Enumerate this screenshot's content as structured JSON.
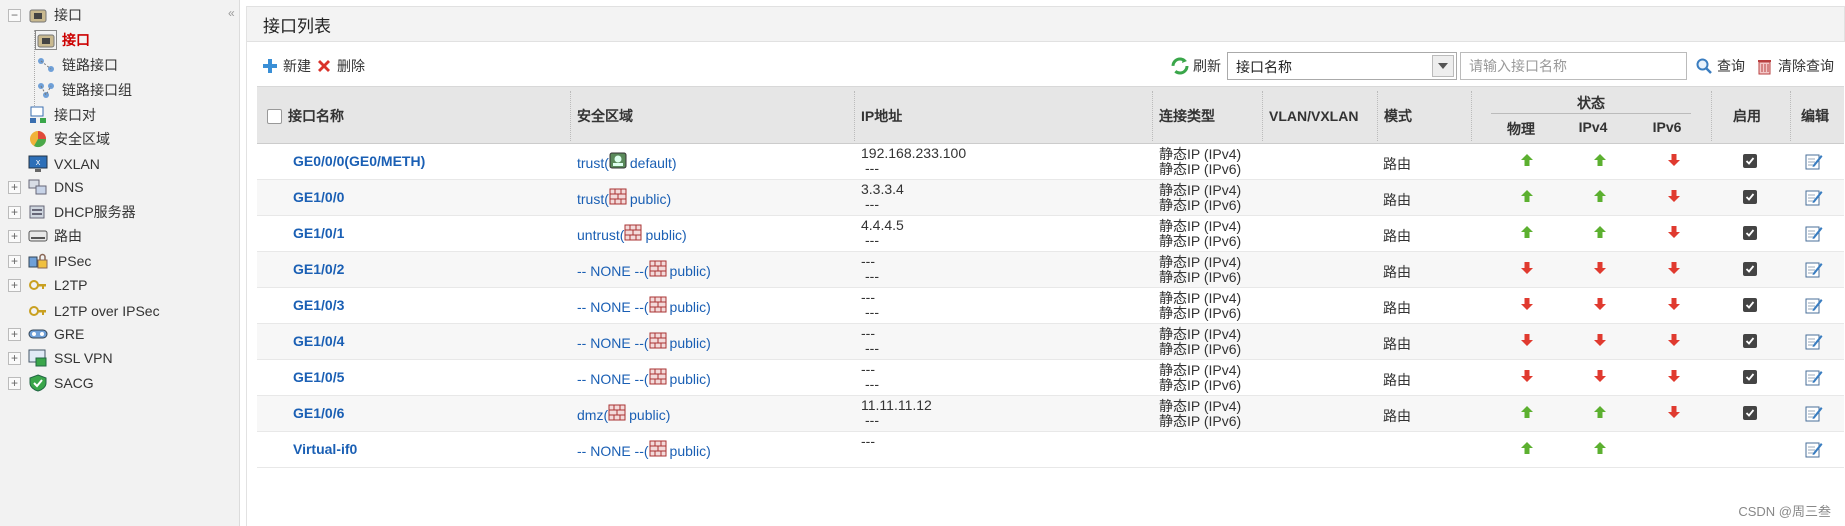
{
  "sidebar": {
    "items": [
      {
        "label": "接口",
        "icon": "interface-folder-icon",
        "toggle": "−"
      },
      {
        "label": "接口",
        "icon": "interface-icon",
        "active": true
      },
      {
        "label": "链路接口",
        "icon": "link-interface-icon"
      },
      {
        "label": "链路接口组",
        "icon": "link-interface-group-icon"
      },
      {
        "label": "接口对",
        "icon": "interface-pair-icon"
      },
      {
        "label": "安全区域",
        "icon": "security-zone-icon"
      },
      {
        "label": "VXLAN",
        "icon": "vxlan-icon"
      },
      {
        "label": "DNS",
        "icon": "dns-icon",
        "toggle": "+"
      },
      {
        "label": "DHCP服务器",
        "icon": "dhcp-server-icon",
        "toggle": "+"
      },
      {
        "label": "路由",
        "icon": "route-icon",
        "toggle": "+"
      },
      {
        "label": "IPSec",
        "icon": "ipsec-icon",
        "toggle": "+"
      },
      {
        "label": "L2TP",
        "icon": "l2tp-icon",
        "toggle": "+"
      },
      {
        "label": "L2TP over IPSec",
        "icon": "l2tp-over-ipsec-icon"
      },
      {
        "label": "GRE",
        "icon": "gre-icon",
        "toggle": "+"
      },
      {
        "label": "SSL VPN",
        "icon": "ssl-vpn-icon",
        "toggle": "+"
      },
      {
        "label": "SACG",
        "icon": "sacg-icon",
        "toggle": "+"
      }
    ],
    "collapse_glyph": "«"
  },
  "panel": {
    "title": "接口列表"
  },
  "toolbar": {
    "new_label": "新建",
    "delete_label": "删除",
    "refresh_label": "刷新",
    "filter_selected": "接口名称",
    "search_placeholder": "请输入接口名称",
    "query_label": "查询",
    "clear_query_label": "清除查询"
  },
  "table": {
    "headers": {
      "name": "接口名称",
      "zone": "安全区域",
      "ip": "IP地址",
      "conn_type": "连接类型",
      "vlan": "VLAN/VXLAN",
      "mode": "模式",
      "status": "状态",
      "physical": "物理",
      "ipv4": "IPv4",
      "ipv6": "IPv6",
      "enable": "启用",
      "edit": "编辑"
    },
    "rows": [
      {
        "name": "GE0/0/0(GE0/METH)",
        "zone_prefix": "trust(",
        "zone_vsys": "default)",
        "zone_icon": "vsys-default-icon",
        "ip1": "192.168.233.100",
        "ip2": "---",
        "conn1": "静态IP (IPv4)",
        "conn2": "静态IP (IPv6)",
        "mode": "路由",
        "phy": "up",
        "v4": "up",
        "v6": "down",
        "enabled": true
      },
      {
        "name": "GE1/0/0",
        "zone_prefix": "trust(",
        "zone_vsys": "public)",
        "zone_icon": "vsys-public-icon",
        "ip1": "3.3.3.4",
        "ip2": "---",
        "conn1": "静态IP (IPv4)",
        "conn2": "静态IP (IPv6)",
        "mode": "路由",
        "phy": "up",
        "v4": "up",
        "v6": "down",
        "enabled": true
      },
      {
        "name": "GE1/0/1",
        "zone_prefix": "untrust(",
        "zone_vsys": "public)",
        "zone_icon": "vsys-public-icon",
        "ip1": "4.4.4.5",
        "ip2": "---",
        "conn1": "静态IP (IPv4)",
        "conn2": "静态IP (IPv6)",
        "mode": "路由",
        "phy": "up",
        "v4": "up",
        "v6": "down",
        "enabled": true
      },
      {
        "name": "GE1/0/2",
        "zone_prefix": "-- NONE --(",
        "zone_vsys": "public)",
        "zone_icon": "vsys-public-icon",
        "ip1": "---",
        "ip2": "---",
        "conn1": "静态IP (IPv4)",
        "conn2": "静态IP (IPv6)",
        "mode": "路由",
        "phy": "down",
        "v4": "down",
        "v6": "down",
        "enabled": true
      },
      {
        "name": "GE1/0/3",
        "zone_prefix": "-- NONE --(",
        "zone_vsys": "public)",
        "zone_icon": "vsys-public-icon",
        "ip1": "---",
        "ip2": "---",
        "conn1": "静态IP (IPv4)",
        "conn2": "静态IP (IPv6)",
        "mode": "路由",
        "phy": "down",
        "v4": "down",
        "v6": "down",
        "enabled": true
      },
      {
        "name": "GE1/0/4",
        "zone_prefix": "-- NONE --(",
        "zone_vsys": "public)",
        "zone_icon": "vsys-public-icon",
        "ip1": "---",
        "ip2": "---",
        "conn1": "静态IP (IPv4)",
        "conn2": "静态IP (IPv6)",
        "mode": "路由",
        "phy": "down",
        "v4": "down",
        "v6": "down",
        "enabled": true
      },
      {
        "name": "GE1/0/5",
        "zone_prefix": "-- NONE --(",
        "zone_vsys": "public)",
        "zone_icon": "vsys-public-icon",
        "ip1": "---",
        "ip2": "---",
        "conn1": "静态IP (IPv4)",
        "conn2": "静态IP (IPv6)",
        "mode": "路由",
        "phy": "down",
        "v4": "down",
        "v6": "down",
        "enabled": true
      },
      {
        "name": "GE1/0/6",
        "zone_prefix": "dmz(",
        "zone_vsys": "public)",
        "zone_icon": "vsys-public-icon",
        "ip1": "11.11.11.12",
        "ip2": "---",
        "conn1": "静态IP (IPv4)",
        "conn2": "静态IP (IPv6)",
        "mode": "路由",
        "phy": "up",
        "v4": "up",
        "v6": "down",
        "enabled": true
      },
      {
        "name": "Virtual-if0",
        "zone_prefix": "-- NONE --(",
        "zone_vsys": "public)",
        "zone_icon": "vsys-public-icon",
        "ip1": "---",
        "ip2": "",
        "conn1": "",
        "conn2": "",
        "mode": "",
        "phy": "up",
        "v4": "up",
        "v6": "",
        "enabled": null
      }
    ]
  },
  "colors": {
    "link": "#1a5fb4",
    "up": "#5cb030",
    "down": "#e03a2f",
    "active_nav": "#cc0000"
  },
  "watermark": "CSDN @周三叁"
}
